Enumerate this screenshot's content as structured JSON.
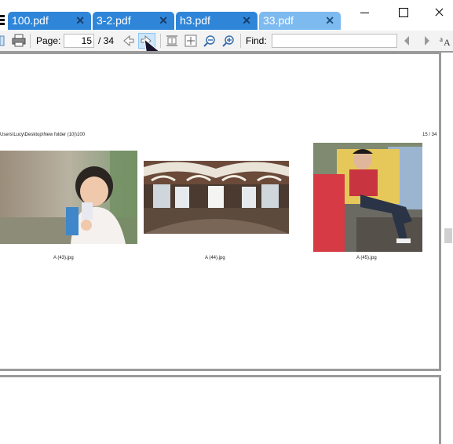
{
  "tabs": [
    {
      "label": "100.pdf",
      "close": "✕",
      "active": false
    },
    {
      "label": "3-2.pdf",
      "close": "✕",
      "active": false
    },
    {
      "label": "h3.pdf",
      "close": "✕",
      "active": false
    },
    {
      "label": "33.pdf",
      "close": "✕",
      "active": true
    }
  ],
  "toolbar": {
    "page_label": "Page:",
    "page_value": "15",
    "page_total": "/ 34",
    "find_label": "Find:",
    "find_value": ""
  },
  "document": {
    "path": "Users\\Lucy\\Desktop\\New folder (10)\\100",
    "page_indicator": "15 / 34",
    "images": [
      {
        "caption": "A (43).jpg"
      },
      {
        "caption": "A (44).jpg"
      },
      {
        "caption": "A (45).jpg"
      }
    ]
  },
  "colors": {
    "tab_inactive": "#2f86d9",
    "tab_active": "#7dbaf0",
    "toolbar_bg": "#f3f3f3"
  }
}
